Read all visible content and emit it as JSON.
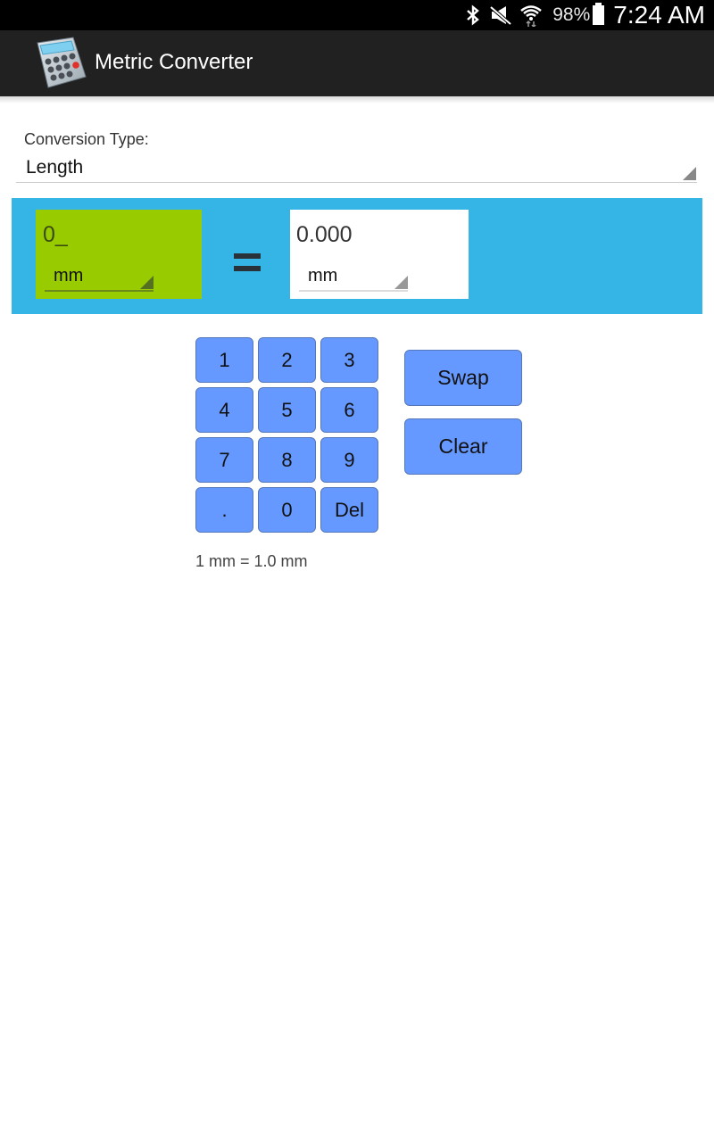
{
  "status_bar": {
    "icons": [
      "bluetooth-icon",
      "mute-icon",
      "wifi-icon"
    ],
    "battery_percent": "98%",
    "time": "7:24 AM"
  },
  "action_bar": {
    "app_icon": "calculator-icon",
    "title": "Metric Converter"
  },
  "conversion_type": {
    "label": "Conversion Type:",
    "selected": "Length"
  },
  "converter": {
    "input_value": "0_",
    "input_unit": "mm",
    "equals_symbol": "=",
    "output_value": "0.000",
    "output_unit": "mm",
    "colors": {
      "panel": "#34b5e5",
      "input_box": "#99cc00",
      "output_box": "#ffffff"
    }
  },
  "keypad": {
    "keys": [
      "1",
      "2",
      "3",
      "4",
      "5",
      "6",
      "7",
      "8",
      "9",
      ".",
      "0",
      "Del"
    ],
    "color": "#6699ff"
  },
  "actions": {
    "swap_label": "Swap",
    "clear_label": "Clear"
  },
  "ratio_text": "1 mm = 1.0 mm"
}
